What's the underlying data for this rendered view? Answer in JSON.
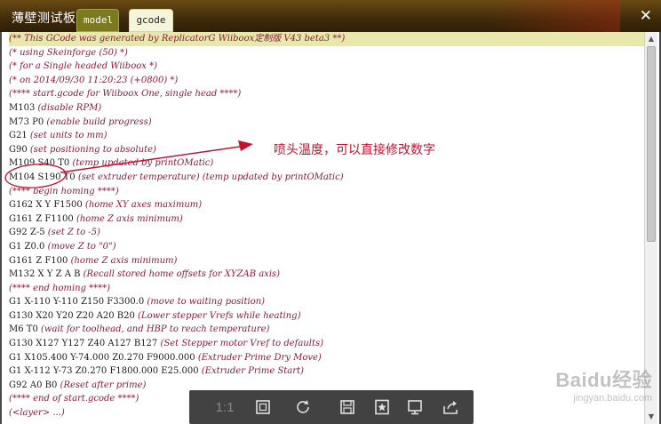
{
  "window": {
    "title": "薄壁测试板",
    "tabs": [
      {
        "label": "model"
      },
      {
        "label": "gcode"
      }
    ],
    "close_label": "✕"
  },
  "code_lines": [
    {
      "cmd": "",
      "comment": "(** This GCode was generated by ReplicatorG Wiiboox定制版 V43 beta3 **)"
    },
    {
      "cmd": "",
      "comment": "(*  using Skeinforge (50)  *)"
    },
    {
      "cmd": "",
      "comment": "(*  for a Single headed Wiiboox  *)"
    },
    {
      "cmd": "",
      "comment": "(*  on 2014/09/30 11:20:23 (+0800) *)"
    },
    {
      "cmd": "",
      "comment": "(**** start.gcode for Wiiboox One, single head ****)"
    },
    {
      "cmd": "M103",
      "comment": "(disable RPM)"
    },
    {
      "cmd": "M73 P0",
      "comment": "(enable build progress)"
    },
    {
      "cmd": "G21",
      "comment": "(set units to mm)"
    },
    {
      "cmd": "G90",
      "comment": "(set positioning to absolute)"
    },
    {
      "cmd": "M109 S40 T0",
      "comment": "(temp updated by printOMatic)"
    },
    {
      "cmd": "M104 S190 T0",
      "comment": "(set extruder temperature) (temp updated by printOMatic)"
    },
    {
      "cmd": "",
      "comment": "(**** begin homing ****)"
    },
    {
      "cmd": "G162 X Y F1500",
      "comment": "(home XY axes maximum)"
    },
    {
      "cmd": "G161 Z F1100",
      "comment": "(home Z axis minimum)"
    },
    {
      "cmd": "G92 Z-5",
      "comment": "(set Z to -5)"
    },
    {
      "cmd": "G1 Z0.0",
      "comment": "(move Z to \"0\")"
    },
    {
      "cmd": "G161 Z F100",
      "comment": "(home Z axis minimum)"
    },
    {
      "cmd": "M132 X Y Z A B",
      "comment": "(Recall stored home offsets for XYZAB axis)"
    },
    {
      "cmd": "",
      "comment": "(**** end homing ****)"
    },
    {
      "cmd": "G1 X-110 Y-110 Z150 F3300.0",
      "comment": "(move to waiting position)"
    },
    {
      "cmd": "G130 X20 Y20 Z20 A20 B20",
      "comment": "(Lower stepper Vrefs while heating)"
    },
    {
      "cmd": "M6 T0",
      "comment": "(wait for toolhead, and HBP to reach temperature)"
    },
    {
      "cmd": "G130 X127 Y127 Z40 A127 B127",
      "comment": "(Set Stepper motor Vref to defaults)"
    },
    {
      "cmd": "G1 X105.400 Y-74.000 Z0.270 F9000.000",
      "comment": "(Extruder Prime Dry Move)"
    },
    {
      "cmd": "G1 X-112 Y-73 Z0.270 F1800.000 E25.000",
      "comment": "(Extruder Prime Start)"
    },
    {
      "cmd": "G92 A0 B0",
      "comment": "(Reset after prime)"
    },
    {
      "cmd": "",
      "comment": "(**** end of start.gcode ****)"
    },
    {
      "cmd": "",
      "comment": "(<layer> ...)"
    }
  ],
  "annotation": {
    "text": "喷头温度，可以直接修改数字"
  },
  "viewer_toolbar": {
    "zoom_label": "1:1",
    "buttons": [
      {
        "name": "fit-screen-icon"
      },
      {
        "name": "rotate-icon"
      },
      {
        "name": "save-icon"
      },
      {
        "name": "bookmark-icon"
      },
      {
        "name": "display-icon"
      },
      {
        "name": "share-icon"
      }
    ]
  },
  "watermark": {
    "logo": "Baidu经验",
    "sub": "jingyan.baidu.com"
  },
  "colors": {
    "comment": "#8b1a3a",
    "highlight": "#e8e8ac",
    "annotation": "#c8102e",
    "titlebar": "#4a3410"
  }
}
